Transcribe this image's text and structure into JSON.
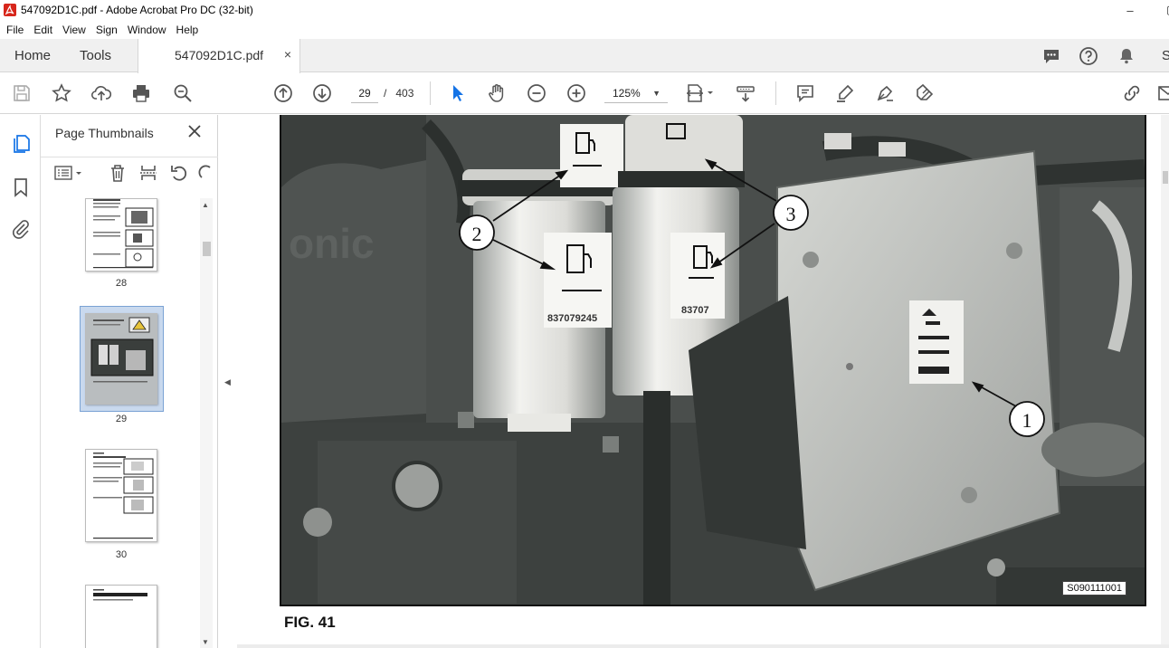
{
  "window": {
    "title": "547092D1C.pdf - Adobe Acrobat Pro DC (32-bit)",
    "minimize": "–",
    "restore": "▢"
  },
  "menu": [
    "File",
    "Edit",
    "View",
    "Sign",
    "Window",
    "Help"
  ],
  "tabs": {
    "home": "Home",
    "tools": "Tools",
    "document": "547092D1C.pdf",
    "close_symbol": "×",
    "right_partial": "S"
  },
  "toolbar": {
    "current_page": "29",
    "page_separator": "/",
    "total_pages": "403",
    "zoom": "125%"
  },
  "thumbnails_panel": {
    "title": "Page Thumbnails",
    "pages": [
      {
        "label": "28",
        "selected": false
      },
      {
        "label": "29",
        "selected": true
      },
      {
        "label": "30",
        "selected": false
      },
      {
        "label": "",
        "selected": false
      }
    ]
  },
  "document": {
    "figure_caption": "FIG. 41",
    "figure_code": "S090111001",
    "callouts": [
      "1",
      "2",
      "3"
    ],
    "filter_part_numbers": [
      "837079245",
      "83707"
    ],
    "brand_partial": "onic"
  },
  "colors": {
    "accent_blue": "#1473e6",
    "acrobat_red": "#d7261b",
    "selection": "#c9d9ee"
  }
}
